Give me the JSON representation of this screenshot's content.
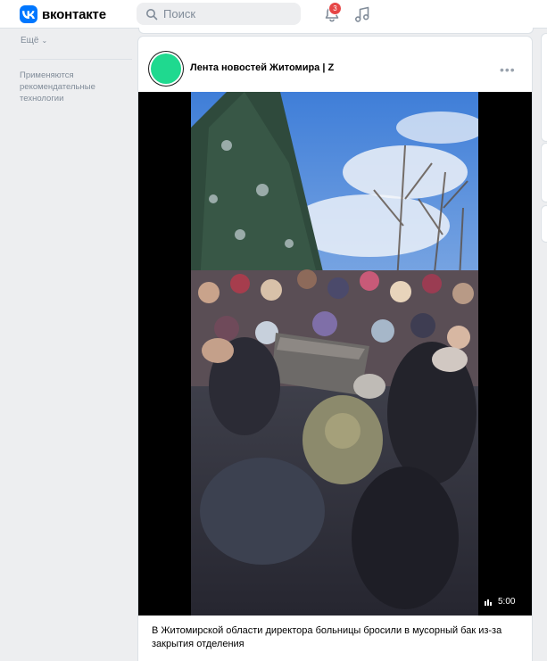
{
  "header": {
    "logo_text": "вконтакте",
    "search_placeholder": "Поиск",
    "notifications_count": "3",
    "icons": [
      "vk-logo-icon",
      "search-icon",
      "bell-icon",
      "music-icon"
    ]
  },
  "sidebar": {
    "more_label": "Ещё",
    "note": "Применяются рекомендательные технологии"
  },
  "post": {
    "author": "Лента новостей Житомира | Z",
    "menu_label": "•••",
    "video_duration": "5:00",
    "caption": "В Житомирской области директора больницы бросили в мусорный бак из-за закрытия отделения"
  },
  "colors": {
    "brand": "#0077ff",
    "badge": "#e64646",
    "avatar": "#1fd98f"
  }
}
